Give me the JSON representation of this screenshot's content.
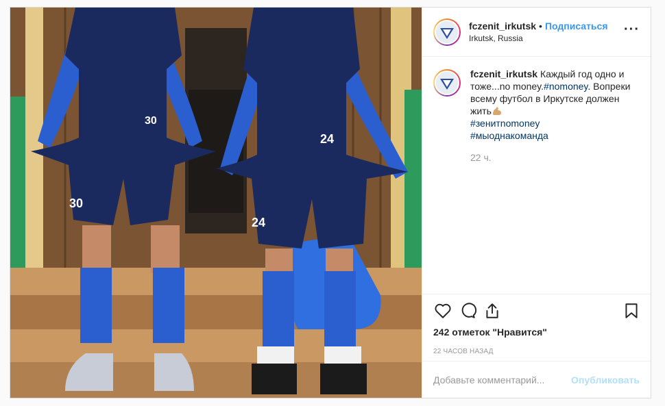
{
  "post": {
    "username": "fczenit_irkutsk",
    "separator": "•",
    "follow_label": "Подписаться",
    "location": "Irkutsk, Russia",
    "more_icon": "more-options-icon"
  },
  "caption": {
    "username": "fczenit_irkutsk",
    "text_part1": "Каждый год одно и тоже...no money.",
    "hashtag_inline": "#nomoney",
    "text_part2": ". Вопреки всему футбол в Иркутске должен жить",
    "emoji": "flexed-biceps-emoji",
    "hashtag1": "#зенитnomoney",
    "hashtag2": "#мыоднакоманда",
    "time": "22 ч."
  },
  "photo": {
    "player_left_number": "30",
    "player_right_number": "24"
  },
  "actions": {
    "icons": [
      "heart-icon",
      "comment-icon",
      "share-icon",
      "bookmark-icon"
    ]
  },
  "likes_label": "242 отметок \"Нравится\"",
  "posted_ago": "22 ЧАСОВ НАЗАД",
  "comment_box": {
    "placeholder": "Добавьте комментарий...",
    "publish_label": "Опубликовать"
  },
  "colors": {
    "accent": "#3897f0",
    "hashtag": "#003569",
    "muted": "#999999",
    "jersey": "#1a2a5e",
    "sleeve": "#2b5fd0"
  }
}
